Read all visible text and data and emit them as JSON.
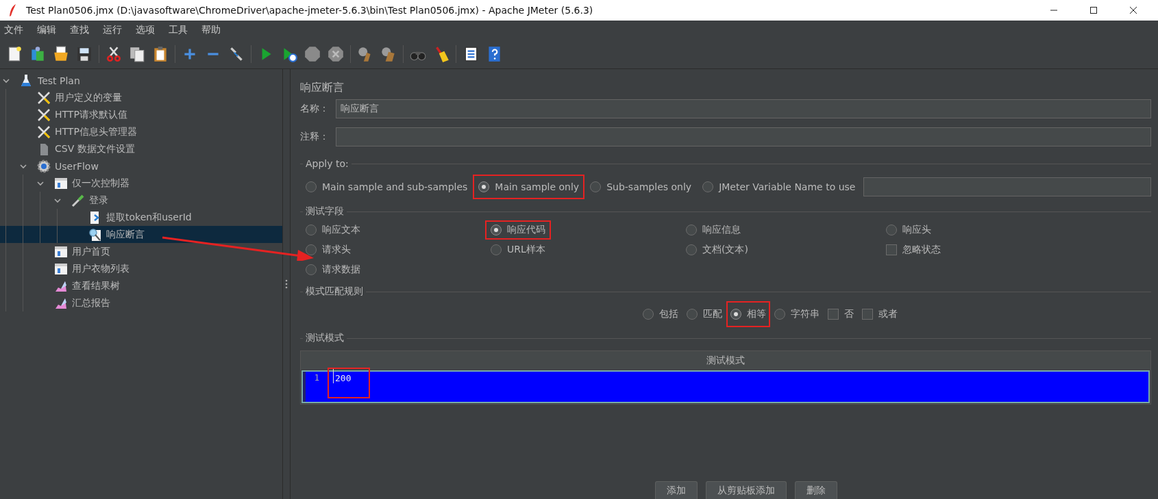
{
  "window": {
    "title": "Test Plan0506.jmx (D:\\javasoftware\\ChromeDriver\\apache-jmeter-5.6.3\\bin\\Test Plan0506.jmx) - Apache JMeter (5.6.3)"
  },
  "menu": [
    "文件",
    "编辑",
    "查找",
    "运行",
    "选项",
    "工具",
    "帮助"
  ],
  "tree": [
    {
      "label": "Test Plan",
      "kind": "plan",
      "selected": false,
      "expanded": true,
      "children": [
        {
          "label": "用户定义的变量",
          "kind": "config",
          "selected": false
        },
        {
          "label": "HTTP请求默认值",
          "kind": "config",
          "selected": false
        },
        {
          "label": "HTTP信息头管理器",
          "kind": "config",
          "selected": false
        },
        {
          "label": "CSV 数据文件设置",
          "kind": "file",
          "selected": false
        },
        {
          "label": "UserFlow",
          "kind": "threads",
          "selected": false,
          "expanded": true,
          "children": [
            {
              "label": "仅一次控制器",
              "kind": "controller",
              "selected": false,
              "expanded": true,
              "children": [
                {
                  "label": "登录",
                  "kind": "sampler",
                  "selected": false,
                  "expanded": true,
                  "children": [
                    {
                      "label": "提取token和userId",
                      "kind": "extractor",
                      "selected": false
                    },
                    {
                      "label": "响应断言",
                      "kind": "assertion",
                      "selected": true
                    }
                  ]
                }
              ]
            },
            {
              "label": "用户首页",
              "kind": "controller",
              "selected": false
            },
            {
              "label": "用户衣物列表",
              "kind": "controller",
              "selected": false
            },
            {
              "label": "查看结果树",
              "kind": "listener",
              "selected": false
            },
            {
              "label": "汇总报告",
              "kind": "listener",
              "selected": false
            }
          ]
        }
      ]
    }
  ],
  "panel": {
    "title": "响应断言",
    "name_label": "名称：",
    "name_value": "响应断言",
    "comment_label": "注释：",
    "apply_to": {
      "legend": "Apply to:",
      "options": [
        {
          "label": "Main sample and sub-samples",
          "selected": false,
          "highlighted": false
        },
        {
          "label": "Main sample only",
          "selected": true,
          "highlighted": true
        },
        {
          "label": "Sub-samples only",
          "selected": false,
          "highlighted": false
        },
        {
          "label": "JMeter Variable Name to use",
          "selected": false,
          "highlighted": false
        }
      ]
    },
    "test_field": {
      "legend": "测试字段",
      "options": [
        {
          "label": "响应文本",
          "kind": "radio",
          "selected": false,
          "highlighted": false
        },
        {
          "label": "响应代码",
          "kind": "radio",
          "selected": true,
          "highlighted": true
        },
        {
          "label": "响应信息",
          "kind": "radio",
          "selected": false,
          "highlighted": false
        },
        {
          "label": "响应头",
          "kind": "radio",
          "selected": false,
          "highlighted": false
        },
        {
          "label": "请求头",
          "kind": "radio",
          "selected": false,
          "highlighted": false
        },
        {
          "label": "URL样本",
          "kind": "radio",
          "selected": false,
          "highlighted": false
        },
        {
          "label": "文档(文本)",
          "kind": "radio",
          "selected": false,
          "highlighted": false
        },
        {
          "label": "忽略状态",
          "kind": "checkbox",
          "checked": false,
          "highlighted": false
        },
        {
          "label": "请求数据",
          "kind": "radio",
          "selected": false,
          "highlighted": false
        }
      ]
    },
    "pattern_rules": {
      "legend": "模式匹配规则",
      "options": [
        {
          "label": "包括",
          "kind": "radio",
          "selected": false,
          "highlighted": false
        },
        {
          "label": "匹配",
          "kind": "radio",
          "selected": false,
          "highlighted": false
        },
        {
          "label": "相等",
          "kind": "radio",
          "selected": true,
          "highlighted": true
        },
        {
          "label": "字符串",
          "kind": "radio",
          "selected": false,
          "highlighted": false
        },
        {
          "label": "否",
          "kind": "checkbox",
          "checked": false,
          "highlighted": false
        },
        {
          "label": "或者",
          "kind": "checkbox",
          "checked": false,
          "highlighted": false
        }
      ]
    },
    "patterns": {
      "legend": "测试模式",
      "column": "测试模式",
      "rows": [
        {
          "line": "1",
          "value": "200",
          "selected": true,
          "highlighted": true
        }
      ]
    },
    "buttons": [
      "添加",
      "从剪贴板添加",
      "删除"
    ]
  }
}
